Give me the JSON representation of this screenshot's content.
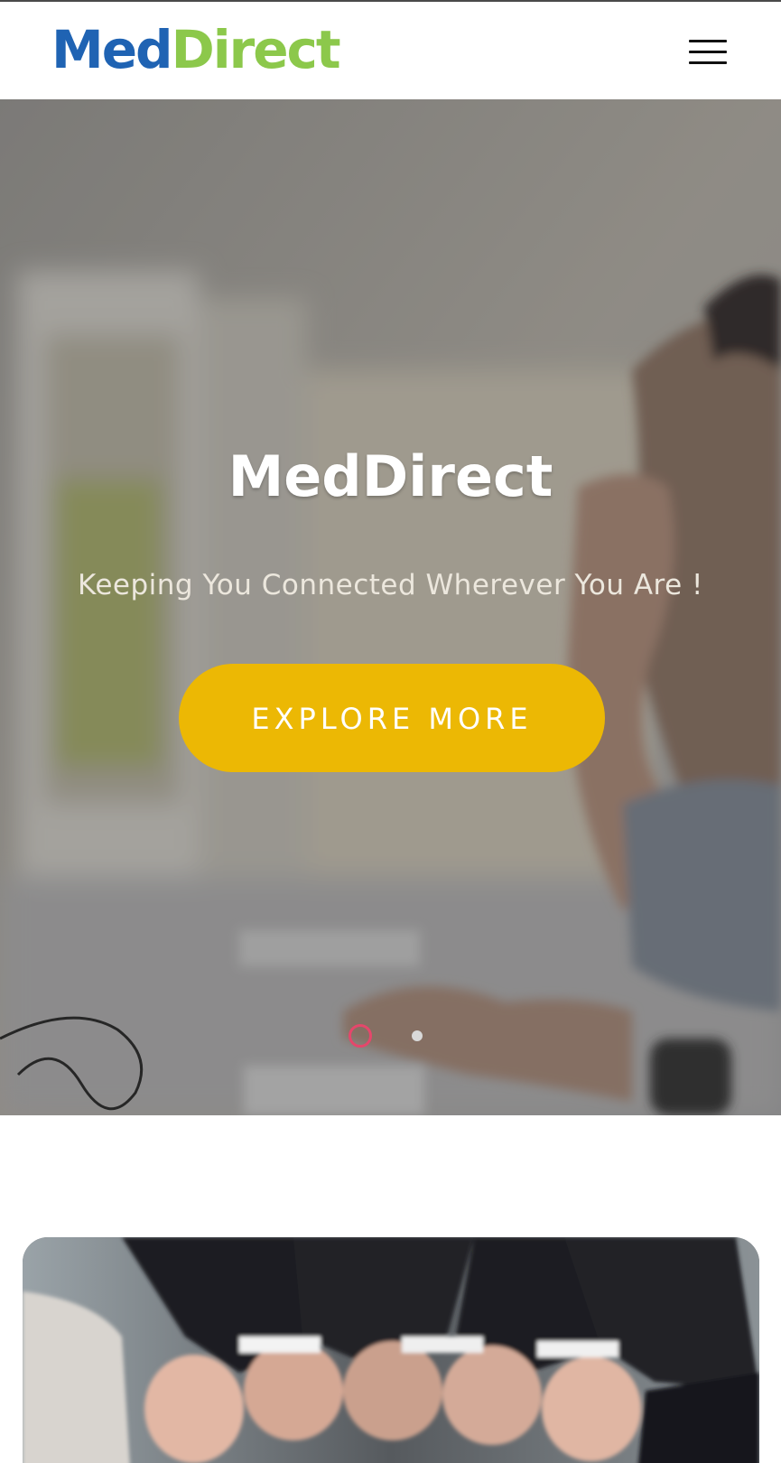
{
  "header": {
    "logo_part1": "Med",
    "logo_part2": "Direct",
    "menu_icon": "hamburger-menu-icon"
  },
  "hero": {
    "title": "MedDirect",
    "subtitle": "Keeping You Connected Wherever You Are !",
    "cta_label": "EXPLORE MORE",
    "slides_total": 2,
    "active_slide": 1
  },
  "colors": {
    "logo_blue": "#1f63b3",
    "logo_green": "#8cc84b",
    "cta_yellow": "#ecb804",
    "active_dot": "#e5476b"
  }
}
